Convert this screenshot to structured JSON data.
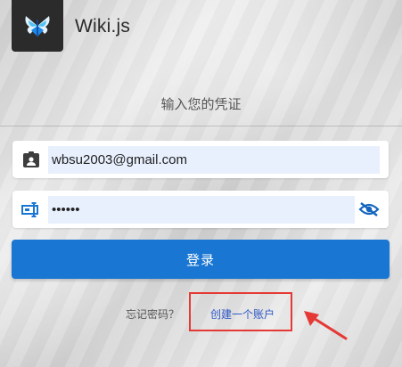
{
  "app": {
    "title": "Wiki.js",
    "logo": "wikijs-logo-icon"
  },
  "login": {
    "subtitle": "输入您的凭证",
    "email": {
      "value": "wbsu2003@gmail.com",
      "icon": "contact-card-icon"
    },
    "password": {
      "value": "••••••",
      "icon": "password-input-icon",
      "toggle_icon": "eye-off-icon"
    },
    "submit_label": "登录",
    "forgot_label": "忘记密码？",
    "create_label": "创建一个账户"
  },
  "annotation": {
    "highlight_color": "#e53935",
    "arrow_icon": "red-arrow-icon"
  },
  "colors": {
    "primary": "#1976d2",
    "autofill": "#e8f0fe",
    "link": "#2f58c7"
  }
}
